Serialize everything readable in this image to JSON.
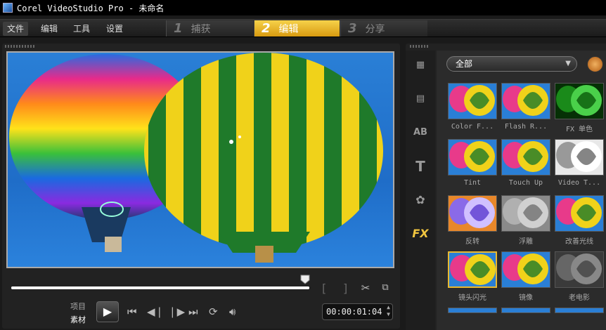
{
  "window": {
    "title": "Corel VideoStudio Pro - 未命名"
  },
  "menu": {
    "items": [
      "文件",
      "编辑",
      "工具",
      "设置"
    ]
  },
  "steps": [
    {
      "num": "1",
      "label": "捕获"
    },
    {
      "num": "2",
      "label": "编辑"
    },
    {
      "num": "3",
      "label": "分享"
    }
  ],
  "player": {
    "mode_project": "项目",
    "mode_clip": "素材",
    "play_icon": "▶",
    "timecode": "00:00:01:04",
    "scrub_progress": 1.0,
    "mark_in": "[",
    "mark_out": "]"
  },
  "sidebar": {
    "fx_label": "FX",
    "text_icon": "T",
    "title_icon": "AB"
  },
  "library": {
    "category": "全部",
    "arrow": "▼",
    "effects": [
      {
        "label": "Color F...",
        "tint": "normal"
      },
      {
        "label": "Flash R...",
        "tint": "normal"
      },
      {
        "label": "FX 单色",
        "tint": "green"
      },
      {
        "label": "Tint",
        "tint": "normal"
      },
      {
        "label": "Touch Up",
        "tint": "normal"
      },
      {
        "label": "Video T...",
        "tint": "gray"
      },
      {
        "label": "反转",
        "tint": "orange"
      },
      {
        "label": "浮雕",
        "tint": "emboss"
      },
      {
        "label": "改善光线",
        "tint": "normal"
      },
      {
        "label": "镜头闪光",
        "tint": "normal"
      },
      {
        "label": "镜像",
        "tint": "normal"
      },
      {
        "label": "老电影",
        "tint": "dark"
      }
    ]
  }
}
